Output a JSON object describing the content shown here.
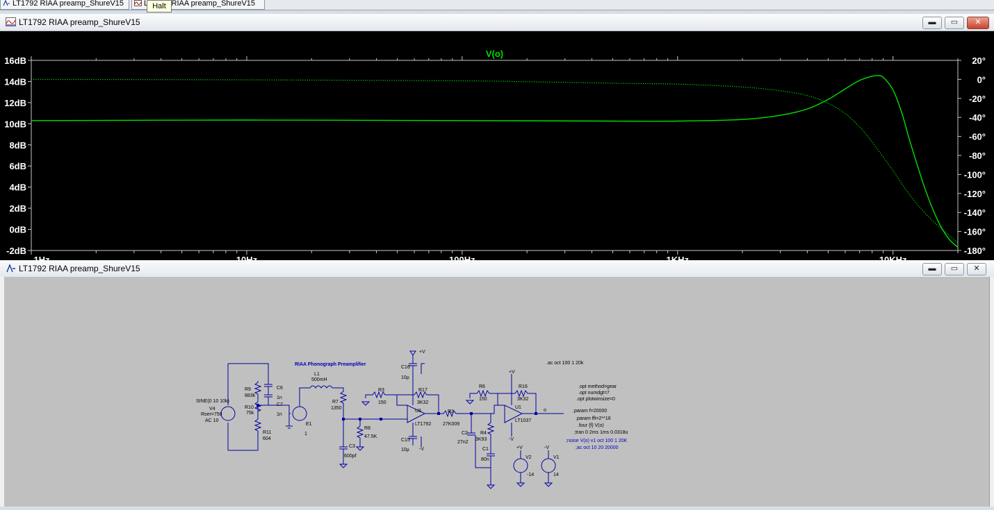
{
  "tabs": [
    {
      "label": "LT1792 RIAA preamp_ShureV15"
    },
    {
      "label": "LT1792 RIAA preamp_ShureV15"
    }
  ],
  "tooltip": "Halt",
  "plot_window": {
    "title": "LT1792 RIAA preamp_ShureV15"
  },
  "schematic_window": {
    "title": "LT1792 RIAA preamp_ShureV15"
  },
  "window_buttons": {
    "minimize": "▬",
    "restore": "▭",
    "close": "✕"
  },
  "chart_data": {
    "type": "line",
    "title": "V(o)",
    "xscale": "log",
    "xlim": [
      1,
      20000
    ],
    "x_ticks": [
      1,
      10,
      100,
      1000,
      10000
    ],
    "x_tick_labels": [
      "1Hz",
      "10Hz",
      "100Hz",
      "1KHz",
      "10KHz"
    ],
    "ylim": [
      -2,
      16
    ],
    "y_ticks": [
      16,
      14,
      12,
      10,
      8,
      6,
      4,
      2,
      0,
      -2
    ],
    "y_tick_labels": [
      "16dB",
      "14dB",
      "12dB",
      "10dB",
      "8dB",
      "6dB",
      "4dB",
      "2dB",
      "0dB",
      "-2dB"
    ],
    "y2lim": [
      -180,
      20
    ],
    "y2_ticks": [
      20,
      0,
      -20,
      -40,
      -60,
      -80,
      -100,
      -120,
      -140,
      -160,
      -180
    ],
    "y2_tick_labels": [
      "20°",
      "0°",
      "-20°",
      "-40°",
      "-60°",
      "-80°",
      "-100°",
      "-120°",
      "-140°",
      "-160°",
      "-180°"
    ],
    "grid": false,
    "colors": {
      "trace": "#00e000",
      "axis": "#c8c8c8",
      "background": "#000000"
    },
    "series": [
      {
        "style": "solid",
        "axis": "left",
        "x": [
          1,
          10,
          100,
          500,
          1000,
          2000,
          3000,
          4000,
          5000,
          6000,
          7000,
          8000,
          8500,
          9000,
          10000,
          11000,
          12000,
          14000,
          16000,
          18000,
          20000
        ],
        "y": [
          10.3,
          10.35,
          10.3,
          10.25,
          10.25,
          10.4,
          10.8,
          11.4,
          12.3,
          13.3,
          14.1,
          14.5,
          14.55,
          14.4,
          13.2,
          11.0,
          8.3,
          4.0,
          1.0,
          -0.8,
          -1.7
        ]
      },
      {
        "style": "dotted",
        "axis": "right",
        "x": [
          1,
          10,
          100,
          200,
          500,
          1000,
          2000,
          3000,
          4000,
          5000,
          6000,
          7000,
          8000,
          10000,
          12000,
          14000,
          16000,
          18000,
          20000
        ],
        "y": [
          0,
          -0.5,
          -1.5,
          -2.5,
          -4,
          -5,
          -8,
          -12,
          -17,
          -25,
          -36,
          -50,
          -66,
          -96,
          -122,
          -140,
          -153,
          -163,
          -172
        ]
      }
    ]
  },
  "schematic": {
    "heading": "RIAA Phonograph Preamplifier",
    "source": {
      "spec": "SINE(0 10 10k)",
      "name": "V4",
      "rser": "Rser=750",
      "ac": "AC 10"
    },
    "components": [
      {
        "name": "R9",
        "value": "883k"
      },
      {
        "name": "R10",
        "value": "75k"
      },
      {
        "name": "R11",
        "value": "604"
      },
      {
        "name": "C6",
        "value": "3.6n"
      },
      {
        "name": "C7",
        "value": "1n"
      },
      {
        "name": "L1",
        "value": "500mH"
      },
      {
        "name": "E1",
        "value": "1"
      },
      {
        "name": "R7",
        "value": "1350"
      },
      {
        "name": "C3",
        "value": "600pf"
      },
      {
        "name": "R8",
        "value": "47.5K"
      },
      {
        "name": "R3",
        "value": "150"
      },
      {
        "name": "C16",
        "value": "10µ"
      },
      {
        "name": "R17",
        "value": "3K32"
      },
      {
        "name": "U3",
        "value": "LT1792"
      },
      {
        "name": "C15",
        "value": "10µ"
      },
      {
        "name": "R2",
        "value": "27K009"
      },
      {
        "name": "C2",
        "value": "27n2"
      },
      {
        "name": "R4",
        "value": "3K93"
      },
      {
        "name": "C1",
        "value": "80n"
      },
      {
        "name": "R6",
        "value": "150"
      },
      {
        "name": "R16",
        "value": "3K32"
      },
      {
        "name": "U1",
        "value": "LT1037"
      },
      {
        "name": "V2",
        "value": "-14"
      },
      {
        "name": "V1",
        "value": "14"
      }
    ],
    "supply_pos": "+V",
    "supply_neg": "-V",
    "out_label": "o",
    "directive_ac": ".ac oct 100 1 20k",
    "options": [
      ".opt method=gear",
      ".opt numdgt=7",
      ".opt plotwinsize=0"
    ],
    "params": [
      ".param f=20000",
      ".param fft=2**16",
      ".four {f} V(o)",
      ";tran 0 2ms 1ms 0.0318u"
    ],
    "comments": [
      ";noise V(o) v1 oct 100 1 20K",
      ";ac oct 10 20 20000"
    ]
  }
}
